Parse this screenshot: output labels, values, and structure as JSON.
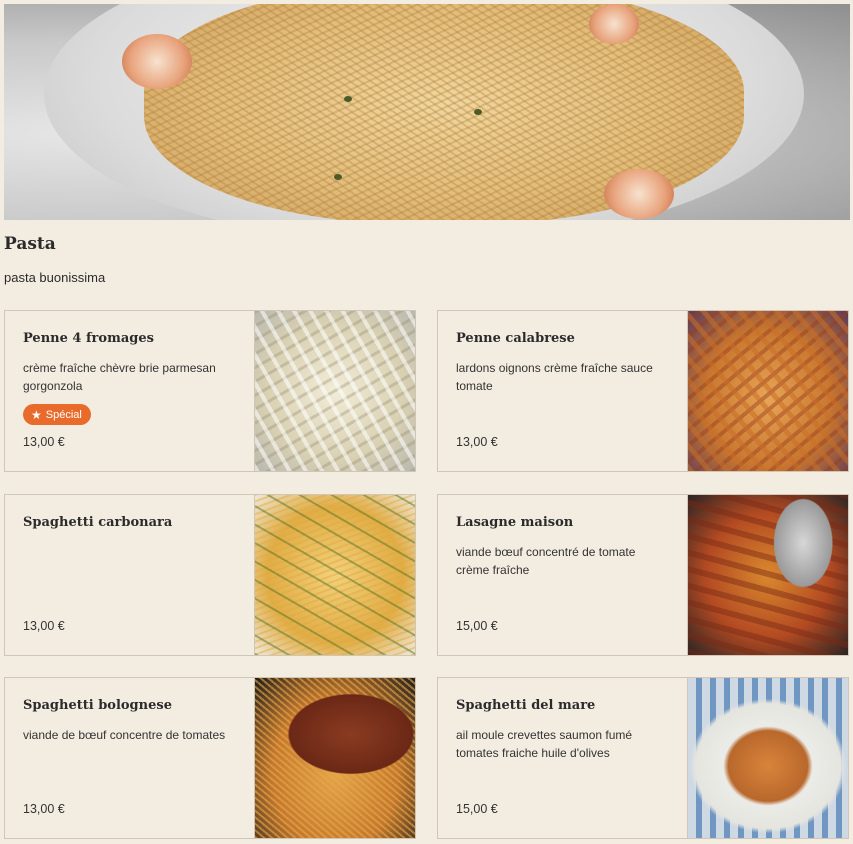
{
  "hero": {
    "image": "pasta-dish-photo"
  },
  "section": {
    "title": "Pasta",
    "description": "pasta buonissima"
  },
  "items": [
    {
      "name": "Penne 4 fromages",
      "description": "crème fraîche chèvre brie parmesan gorgonzola",
      "badge": "Spécial",
      "price": "13,00 €",
      "image": "penne-4-fromages-photo"
    },
    {
      "name": "Penne calabrese",
      "description": "lardons oignons crème fraîche sauce tomate",
      "price": "13,00 €",
      "image": "penne-calabrese-photo"
    },
    {
      "name": "Spaghetti carbonara",
      "description": "",
      "price": "13,00 €",
      "image": "spaghetti-carbonara-photo"
    },
    {
      "name": "Lasagne maison",
      "description": "viande bœuf concentré de tomate crème fraîche",
      "price": "15,00 €",
      "image": "lasagne-maison-photo"
    },
    {
      "name": "Spaghetti bolognese",
      "description": "viande de bœuf concentre de tomates",
      "price": "13,00 €",
      "image": "spaghetti-bolognese-photo"
    },
    {
      "name": "Spaghetti del mare",
      "description": "ail moule crevettes saumon fumé tomates fraiche huile d'olives",
      "price": "15,00 €",
      "image": "spaghetti-del-mare-photo"
    }
  ],
  "colors": {
    "background": "#f3ede1",
    "badge": "#e96b2b",
    "border": "#cfc6b6"
  },
  "icons": {
    "badge": "star-icon"
  }
}
